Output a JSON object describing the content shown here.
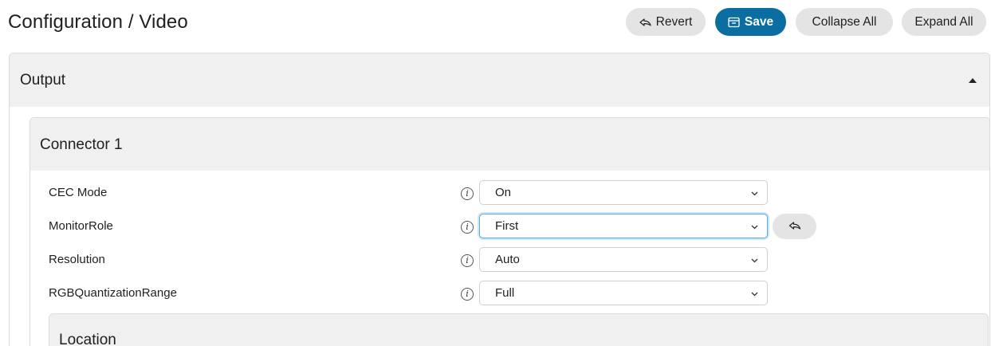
{
  "header": {
    "title": "Configuration / Video",
    "revert_label": "Revert",
    "save_label": "Save",
    "collapse_label": "Collapse All",
    "expand_label": "Expand All"
  },
  "section": {
    "title": "Output",
    "expanded": true
  },
  "connector": {
    "title": "Connector 1",
    "rows": [
      {
        "label": "CEC Mode",
        "info": "i",
        "value": "On"
      },
      {
        "label": "MonitorRole",
        "info": "i",
        "value": "First",
        "focused": true,
        "modified": true
      },
      {
        "label": "Resolution",
        "info": "i",
        "value": "Auto"
      },
      {
        "label": "RGBQuantizationRange",
        "info": "i",
        "value": "Full"
      }
    ]
  },
  "location": {
    "title": "Location"
  },
  "colors": {
    "primary": "#0a6ea3",
    "pill_bg": "#e4e4e4",
    "header_bg": "#f0f0f0",
    "focus_border": "#5aa9d6"
  },
  "icons": {
    "revert": "revert-arrow-icon",
    "save": "save-tray-icon",
    "collapse_caret": "caret-up-icon",
    "dropdown": "chevron-down-icon",
    "info": "info-icon"
  }
}
